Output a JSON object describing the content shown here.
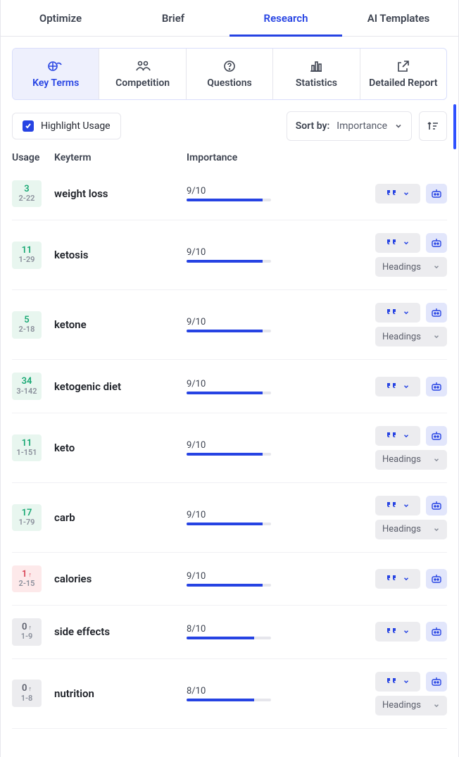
{
  "top_tabs": [
    "Optimize",
    "Brief",
    "Research",
    "AI Templates"
  ],
  "active_top_tab": 2,
  "sub_tabs": [
    "Key Terms",
    "Competition",
    "Questions",
    "Statistics",
    "Detailed Report"
  ],
  "active_sub_tab": 0,
  "highlight_label": "Highlight Usage",
  "sort_by_label": "Sort by:",
  "sort_value": "Importance",
  "columns": {
    "usage": "Usage",
    "keyterm": "Keyterm",
    "importance": "Importance"
  },
  "headings_label": "Headings",
  "rows": [
    {
      "count": "3",
      "range": "2-22",
      "state": "green",
      "arrow": "",
      "term": "weight loss",
      "score": "9/10",
      "fill": 90,
      "headings": false
    },
    {
      "count": "11",
      "range": "1-29",
      "state": "green",
      "arrow": "",
      "term": "ketosis",
      "score": "9/10",
      "fill": 90,
      "headings": true
    },
    {
      "count": "5",
      "range": "2-18",
      "state": "green",
      "arrow": "",
      "term": "ketone",
      "score": "9/10",
      "fill": 90,
      "headings": true
    },
    {
      "count": "34",
      "range": "3-142",
      "state": "green",
      "arrow": "",
      "term": "ketogenic diet",
      "score": "9/10",
      "fill": 90,
      "headings": false
    },
    {
      "count": "11",
      "range": "1-151",
      "state": "green",
      "arrow": "",
      "term": "keto",
      "score": "9/10",
      "fill": 90,
      "headings": true
    },
    {
      "count": "17",
      "range": "1-79",
      "state": "green",
      "arrow": "",
      "term": "carb",
      "score": "9/10",
      "fill": 90,
      "headings": true
    },
    {
      "count": "1",
      "range": "2-15",
      "state": "red",
      "arrow": "↑",
      "term": "calories",
      "score": "9/10",
      "fill": 90,
      "headings": false
    },
    {
      "count": "0",
      "range": "1-9",
      "state": "grey",
      "arrow": "↑",
      "term": "side effects",
      "score": "8/10",
      "fill": 80,
      "headings": false
    },
    {
      "count": "0",
      "range": "1-8",
      "state": "grey",
      "arrow": "↑",
      "term": "nutrition",
      "score": "8/10",
      "fill": 80,
      "headings": true
    }
  ]
}
